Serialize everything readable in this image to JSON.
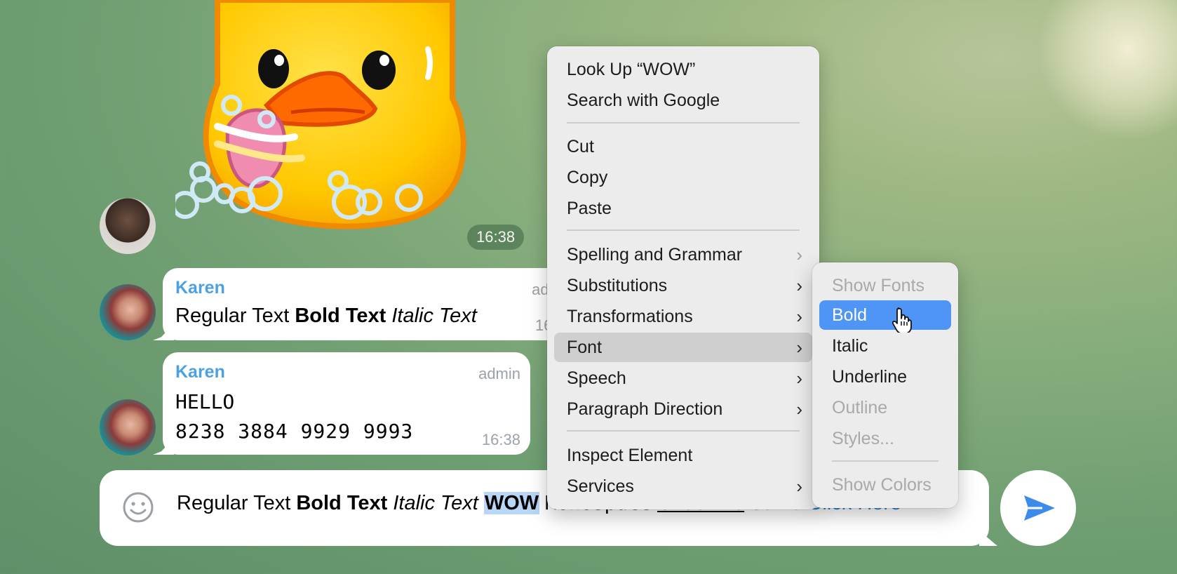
{
  "chat": {
    "sticker_time": "16:38",
    "messages": [
      {
        "sender": "Karen",
        "role": "admin",
        "time": "16:38",
        "parts": {
          "regular": "Regular Text",
          "bold": "Bold Text",
          "italic": "Italic Text"
        }
      },
      {
        "sender": "Karen",
        "role": "admin",
        "time": "16:38",
        "lines": [
          "HELLO",
          "8238 3884 9929 9993"
        ]
      }
    ]
  },
  "composer": {
    "regular": "Regular Text",
    "bold": "Bold Text",
    "italic": "Italic Text",
    "selected": "WOW",
    "monospace": "Monospace",
    "underline": "Underline",
    "strike": "Strike",
    "link": "Click Here"
  },
  "context_menu": {
    "items": [
      "Look Up “WOW”",
      "Search with Google",
      "Cut",
      "Copy",
      "Paste",
      "Spelling and Grammar",
      "Substitutions",
      "Transformations",
      "Font",
      "Speech",
      "Paragraph Direction",
      "Inspect Element",
      "Services"
    ],
    "hovered": "Font"
  },
  "font_submenu": {
    "items": [
      "Show Fonts",
      "Bold",
      "Italic",
      "Underline",
      "Outline",
      "Styles...",
      "Show Colors"
    ],
    "selected": "Bold",
    "disabled": [
      "Show Fonts",
      "Outline",
      "Styles...",
      "Show Colors"
    ]
  },
  "colors": {
    "accent": "#4f95f5",
    "sender_name": "#4ea1e0",
    "link": "#2f80d0"
  }
}
